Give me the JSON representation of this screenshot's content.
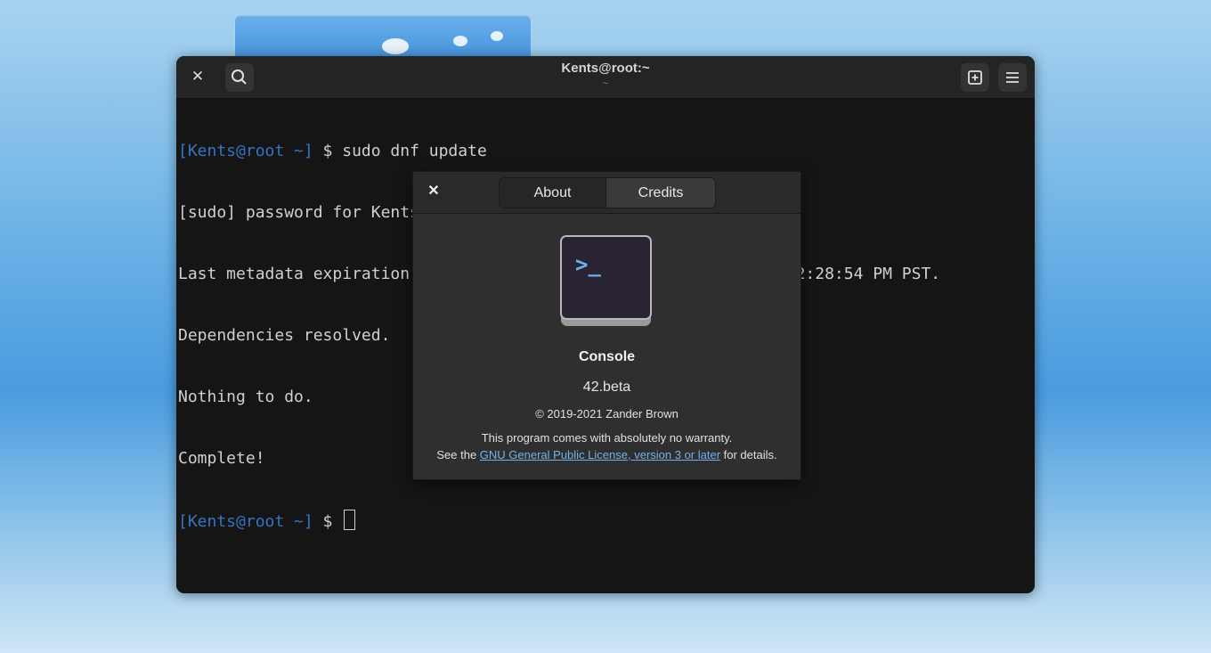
{
  "terminal": {
    "title": "Kents@root:~",
    "subtitle": "~",
    "lines": [
      {
        "prompt": "[Kents@root ~]",
        "text": " $ sudo dnf update"
      },
      {
        "prompt": "",
        "text": "[sudo] password for Kents:"
      },
      {
        "prompt": "",
        "text": "Last metadata expiration check: 1:09:54 ago on Fri 20 May 2022 02:28:54 PM PST."
      },
      {
        "prompt": "",
        "text": "Dependencies resolved."
      },
      {
        "prompt": "",
        "text": "Nothing to do."
      },
      {
        "prompt": "",
        "text": "Complete!"
      },
      {
        "prompt": "[Kents@root ~]",
        "text": " $ "
      }
    ],
    "icons": {
      "close": "close-icon",
      "search": "search-icon",
      "new_tab": "new-tab-icon",
      "menu": "hamburger-menu-icon"
    }
  },
  "about": {
    "tabs": [
      "About",
      "Credits"
    ],
    "active_tab": "About",
    "app_name": "Console",
    "version": "42.beta",
    "copyright": "© 2019-2021 Zander Brown",
    "warranty_line": "This program comes with absolutely no warranty.",
    "license_prefix": "See the ",
    "license_link": "GNU General Public License, version 3 or later",
    "license_suffix": " for details.",
    "icon_glyph": ">_"
  },
  "colors": {
    "prompt": "#3574c4",
    "link": "#78aeed",
    "terminal_bg": "#151515",
    "dialog_bg": "#2f2f2f"
  }
}
